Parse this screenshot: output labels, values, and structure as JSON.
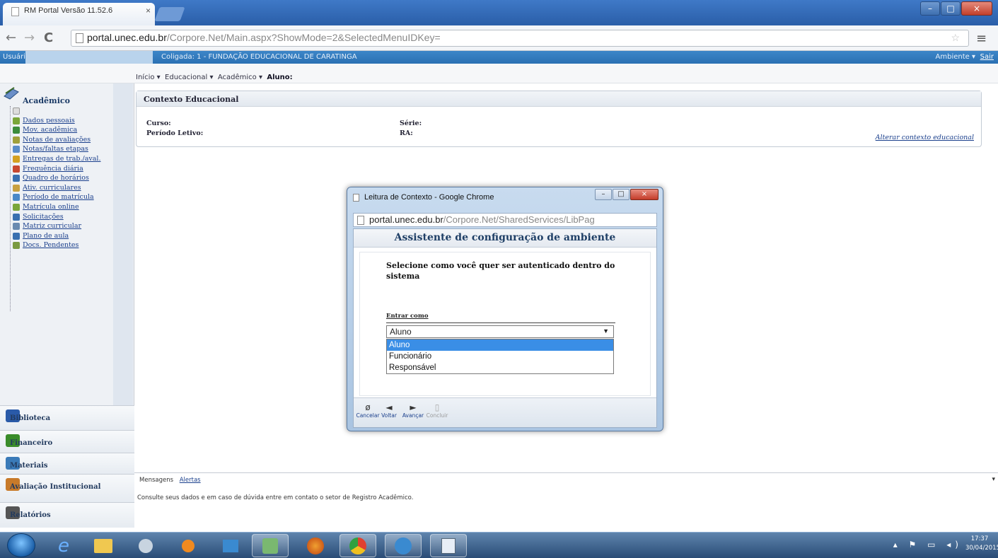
{
  "browser": {
    "tab_title": "RM Portal Versão 11.52.6",
    "tab_close": "×",
    "url_host": "portal.unec.edu.br",
    "url_path": "/Corpore.Net/Main.aspx?ShowMode=2&SelectedMenuIDKey=",
    "back_icon": "←",
    "forward_icon": "→",
    "reload_icon": "C",
    "star_icon": "☆",
    "menu_icon": "≡",
    "min": "–",
    "max": "□",
    "close": "×"
  },
  "app_bar": {
    "user_label": "Usuário",
    "coligada": "Coligada: 1 - FUNDAÇÃO EDUCACIONAL DE CARATINGA",
    "ambiente": "Ambiente ▾",
    "sair": "Sair"
  },
  "breadcrumb": {
    "inicio": "Início ▾",
    "educacional": "Educacional ▾",
    "academico": "Acadêmico ▾",
    "aluno": "Aluno:"
  },
  "sidebar": {
    "header": "Acadêmico",
    "items": [
      {
        "label": "Dados pessoais",
        "color": "#7aa63a"
      },
      {
        "label": "Mov. acadêmica",
        "color": "#3c8c3c"
      },
      {
        "label": "Notas de avaliações",
        "color": "#a0a03a"
      },
      {
        "label": "Notas/faltas etapas",
        "color": "#5a8cc8"
      },
      {
        "label": "Entregas de trab./aval.",
        "color": "#d4a020"
      },
      {
        "label": "Frequência diária",
        "color": "#c84830"
      },
      {
        "label": "Quadro de horários",
        "color": "#3a70b0"
      },
      {
        "label": "Ativ. curriculares",
        "color": "#c8a040"
      },
      {
        "label": "Período de matrícula",
        "color": "#4a88c8"
      },
      {
        "label": "Matrícula online",
        "color": "#7aa63a"
      },
      {
        "label": "Solicitações",
        "color": "#3a70b0"
      },
      {
        "label": "Matriz curricular",
        "color": "#6a8ab0"
      },
      {
        "label": "Plano de aula",
        "color": "#3a70b0"
      },
      {
        "label": "Docs. Pendentes",
        "color": "#7a9a40"
      }
    ],
    "sections": [
      {
        "label": "Biblioteca",
        "color": "#2a5aa8"
      },
      {
        "label": "Financeiro",
        "color": "#3a8c2a"
      },
      {
        "label": "Materiais",
        "color": "#3a7ab8"
      },
      {
        "label": "Avaliação Institucional",
        "color": "#c87a2a"
      },
      {
        "label": "Relatórios",
        "color": "#555555"
      }
    ]
  },
  "context": {
    "title": "Contexto Educacional",
    "curso": "Curso:",
    "periodo": "Período Letivo:",
    "serie": "Série:",
    "ra": "RA:",
    "alterar": "Alterar contexto educacional"
  },
  "dialog": {
    "window_title": "Leitura de Contexto - Google Chrome",
    "url_host": "portal.unec.edu.br",
    "url_path": "/Corpore.Net/SharedServices/LibPag",
    "heading": "Assistente de configuração de ambiente",
    "question": "Selecione como você quer ser autenticado dentro do sistema",
    "field_label": "Entrar como",
    "selected": "Aluno",
    "options": [
      "Aluno",
      "Funcionário",
      "Responsável"
    ],
    "buttons": {
      "cancelar": "Cancelar",
      "voltar": "Voltar",
      "avancar": "Avançar",
      "concluir": "Concluir"
    }
  },
  "messages": {
    "tab_mensagens": "Mensagens",
    "tab_alertas": "Alertas",
    "text": "Consulte seus dados e em caso de dúvida entre em contato o setor de Registro Acadêmico."
  },
  "taskbar": {
    "time": "17:37",
    "date": "30/04/2015",
    "tray": "▴ ⚑ ▭ ◂)"
  }
}
